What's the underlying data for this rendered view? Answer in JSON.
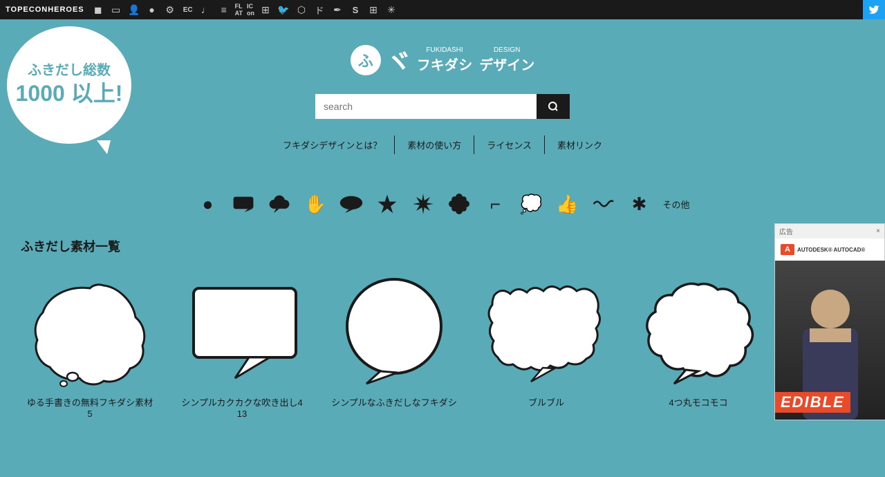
{
  "topnav": {
    "brand": "TOPECONHEROES",
    "twitter_icon": "🐦",
    "icons": [
      "◼",
      "▭",
      "👤",
      "●",
      "⚙",
      "EC",
      "♪",
      "≡",
      "FL AT",
      "IC on",
      "⊞",
      "🐦",
      "◼",
      "🐦",
      "ド",
      "✒",
      "S",
      "⊞",
      "✳"
    ]
  },
  "badge": {
    "line1": "ふきだし総数",
    "line2": "1000 以上!"
  },
  "logo": {
    "circle_char": "ふ",
    "kana": "ヾ",
    "furigana_label": "FUKIDASHI",
    "katakana1": "フキダシ",
    "design_label": "DESIGN",
    "katakana2": "デザイン"
  },
  "search": {
    "placeholder": "search",
    "button_icon": "🔍"
  },
  "navlinks": [
    {
      "label": "フキダシデザインとは？"
    },
    {
      "label": "素材の使い方"
    },
    {
      "label": "ライセンス"
    },
    {
      "label": "素材リンク"
    }
  ],
  "filter_icons": [
    {
      "name": "circle",
      "symbol": "●"
    },
    {
      "name": "speech-rect",
      "symbol": "▬"
    },
    {
      "name": "cloud",
      "symbol": "❋"
    },
    {
      "name": "hand",
      "symbol": "✋"
    },
    {
      "name": "oval-speech",
      "symbol": "💬"
    },
    {
      "name": "star-burst",
      "symbol": "✳"
    },
    {
      "name": "splash",
      "symbol": "✸"
    },
    {
      "name": "flower",
      "symbol": "❀"
    },
    {
      "name": "arrow-corner",
      "symbol": "⌐"
    },
    {
      "name": "round-speech",
      "symbol": "💭"
    },
    {
      "name": "thumb-up",
      "symbol": "👍"
    },
    {
      "name": "wave",
      "symbol": "〜"
    },
    {
      "name": "asterisk",
      "symbol": "✱"
    },
    {
      "name": "other",
      "label": "その他"
    }
  ],
  "section": {
    "title": "ふきだし素材一覧"
  },
  "cards": [
    {
      "label": "ゆる手書きの無料フキダシ素材",
      "count": "5",
      "type": "cloud"
    },
    {
      "label": "シンプルカクカクな吹き出し4",
      "count": "13",
      "type": "rect-speech"
    },
    {
      "label": "シンプルなふきだしなフキダシ",
      "count": "",
      "type": "circle-speech"
    },
    {
      "label": "ブルブル",
      "count": "",
      "type": "wavy-speech"
    },
    {
      "label": "4つ丸モコモコ",
      "count": "",
      "type": "mokomoko"
    }
  ],
  "ad": {
    "header_label": "広告",
    "close_label": "×",
    "brand": "AUTODESK® AUTOCAD®",
    "logo_text": "A",
    "word": "EDIBLE"
  }
}
